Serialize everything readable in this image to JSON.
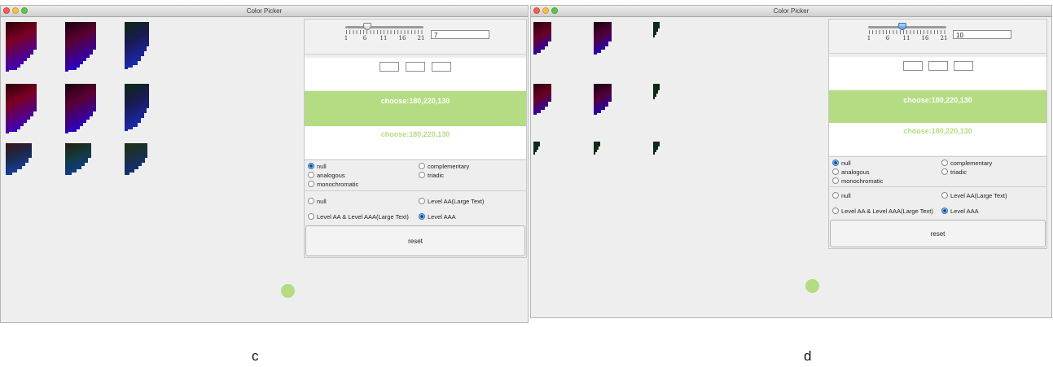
{
  "window_c": {
    "title": "Color Picker",
    "slider": {
      "ticks": [
        "1",
        "6",
        "11",
        "16",
        "21"
      ],
      "value": "7"
    },
    "choose_label_band": "choose:180,220,130",
    "choose_label_text": "choose:180,220,130",
    "scheme_options": [
      "null",
      "complementary",
      "analogous",
      "triadic",
      "monochromatic"
    ],
    "scheme_selected": "null",
    "contrast_options": [
      "null",
      "Level AA(Large Text)",
      "Level AA & Level AAA(Large Text)",
      "Level AAA"
    ],
    "contrast_selected": "Level AAA",
    "reset_label": "reset",
    "caption": "c"
  },
  "window_d": {
    "title": "Color Picker",
    "slider": {
      "ticks": [
        "1",
        "6",
        "11",
        "16",
        "21"
      ],
      "value": "10"
    },
    "choose_label_band": "choose:180,220,130",
    "choose_label_text": "choose:180,220,130",
    "scheme_options": [
      "null",
      "complementary",
      "analogous",
      "triadic",
      "monochromatic"
    ],
    "scheme_selected": "null",
    "contrast_options": [
      "null",
      "Level AA(Large Text)",
      "Level AA & Level AAA(Large Text)",
      "Level AAA"
    ],
    "contrast_selected": "Level AAA",
    "reset_label": "reset",
    "caption": "d"
  },
  "colors": {
    "chosen": "#b4dc82",
    "background": "#eeeeee"
  },
  "icons": {
    "close": "close-traffic-light-icon",
    "minimize": "minimize-traffic-light-icon",
    "zoom": "zoom-traffic-light-icon"
  }
}
